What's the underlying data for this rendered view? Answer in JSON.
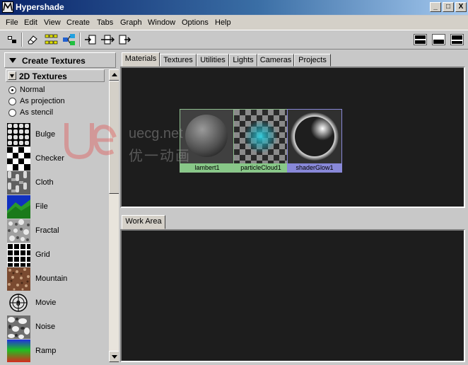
{
  "window": {
    "title": "Hypershade",
    "controls": {
      "minimize": "_",
      "maximize": "□",
      "close": "X"
    }
  },
  "menu": [
    "File",
    "Edit",
    "View",
    "Create",
    "Tabs",
    "Graph",
    "Window",
    "Options",
    "Help"
  ],
  "toolbar": {
    "tools": [
      "graph-icon",
      "eraser-icon",
      "node-tree-icon",
      "node-network-icon",
      "input-connections-icon",
      "in-out-connections-icon",
      "output-connections-icon"
    ],
    "layouts": [
      "layout-top-bottom-icon",
      "layout-bottom-only-icon",
      "layout-top-only-icon"
    ]
  },
  "left_panel": {
    "header": "Create Textures",
    "section": "2D Textures",
    "placement_options": [
      {
        "label": "Normal",
        "checked": true
      },
      {
        "label": "As projection",
        "checked": false
      },
      {
        "label": "As stencil",
        "checked": false
      }
    ],
    "textures": [
      "Bulge",
      "Checker",
      "Cloth",
      "File",
      "Fractal",
      "Grid",
      "Mountain",
      "Movie",
      "Noise",
      "Ramp"
    ]
  },
  "tabs": [
    "Materials",
    "Textures",
    "Utilities",
    "Lights",
    "Cameras",
    "Projects"
  ],
  "active_tab": "Materials",
  "materials": [
    {
      "label": "lambert1",
      "label_color": "#88c888"
    },
    {
      "label": "particleCloud1",
      "label_color": "#88c888"
    },
    {
      "label": "shaderGlow1",
      "label_color": "#8888d8"
    }
  ],
  "work_area": {
    "tab": "Work Area"
  },
  "watermark": {
    "text1": "uecg.net",
    "text2": "优一动画"
  }
}
